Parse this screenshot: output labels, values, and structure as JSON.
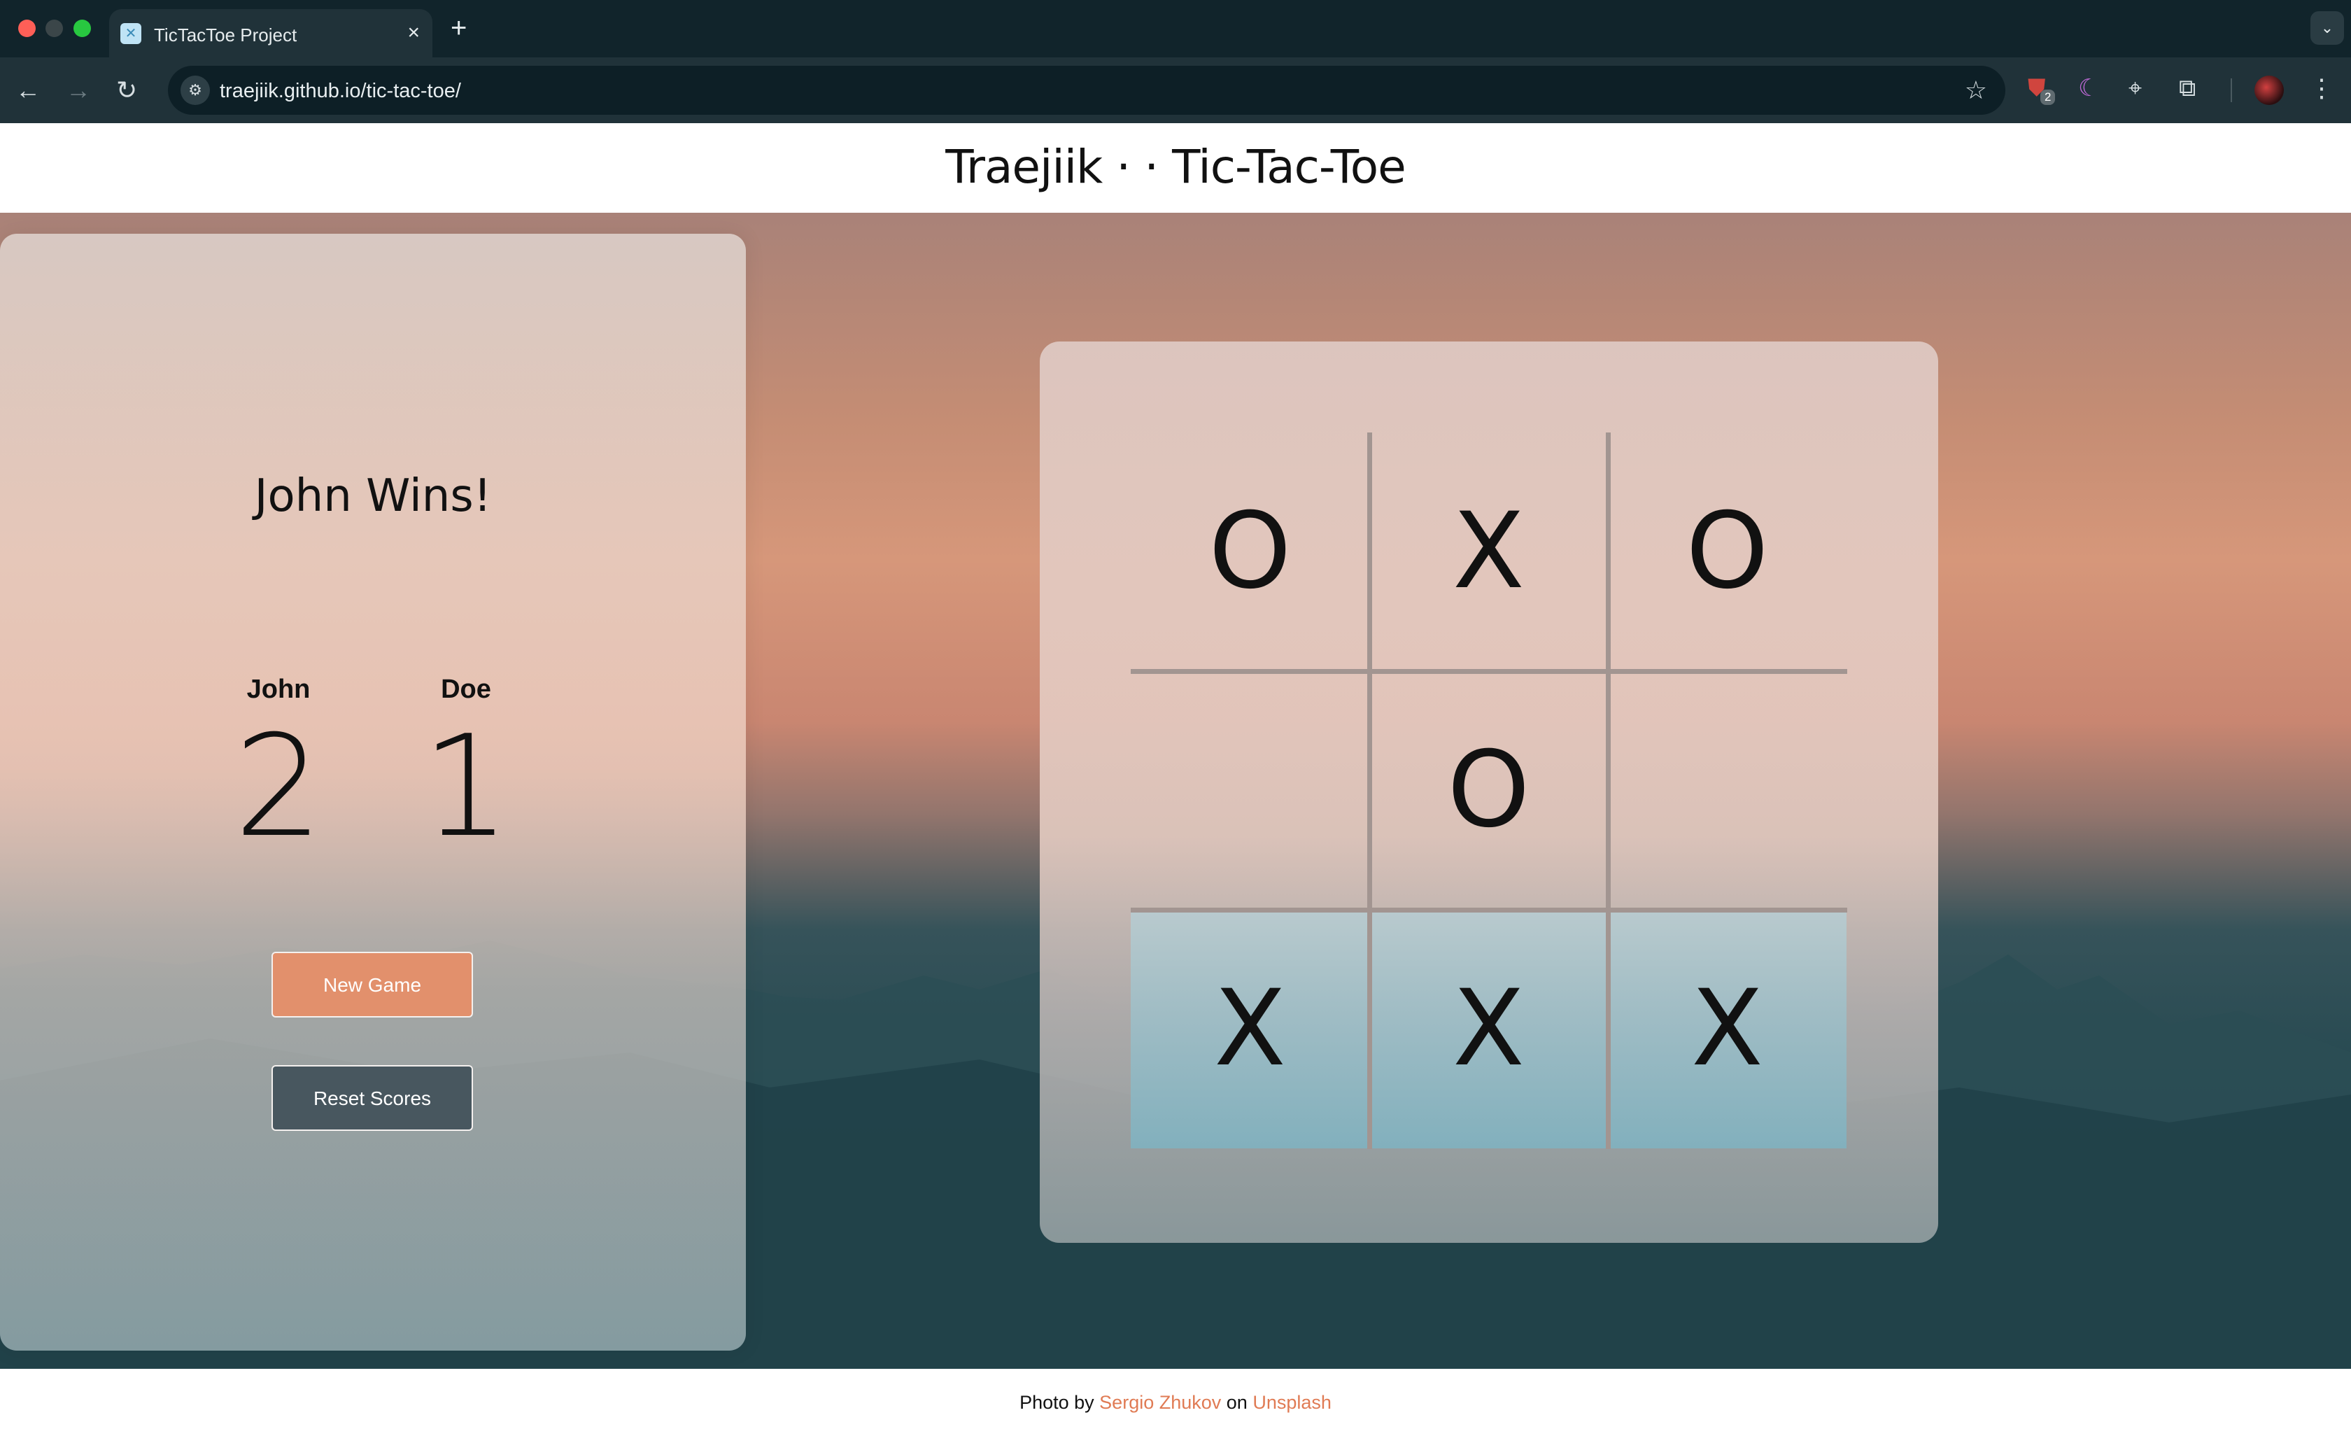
{
  "browser": {
    "tab_title": "TicTacToe Project",
    "tab_close": "×",
    "new_tab": "+",
    "url": "traejiik.github.io/tic-tac-toe/",
    "extension_badge": "2"
  },
  "header": {
    "title": "Traejiik · · Tic-Tac-Toe"
  },
  "game": {
    "status": "John Wins!",
    "players": [
      {
        "name": "John",
        "score": "2"
      },
      {
        "name": "Doe",
        "score": "1"
      }
    ],
    "new_game_label": "New Game",
    "reset_label": "Reset Scores",
    "board": [
      "O",
      "X",
      "O",
      "",
      "O",
      "",
      "X",
      "X",
      "X"
    ],
    "winning_cells": [
      6,
      7,
      8
    ]
  },
  "footer": {
    "prefix": "Photo by",
    "author": "Sergio Zhukov",
    "middle": "on",
    "source": "Unsplash"
  },
  "colors": {
    "accent_orange": "#e2906c",
    "dark_slate": "#48575f",
    "link": "#e07b54"
  }
}
